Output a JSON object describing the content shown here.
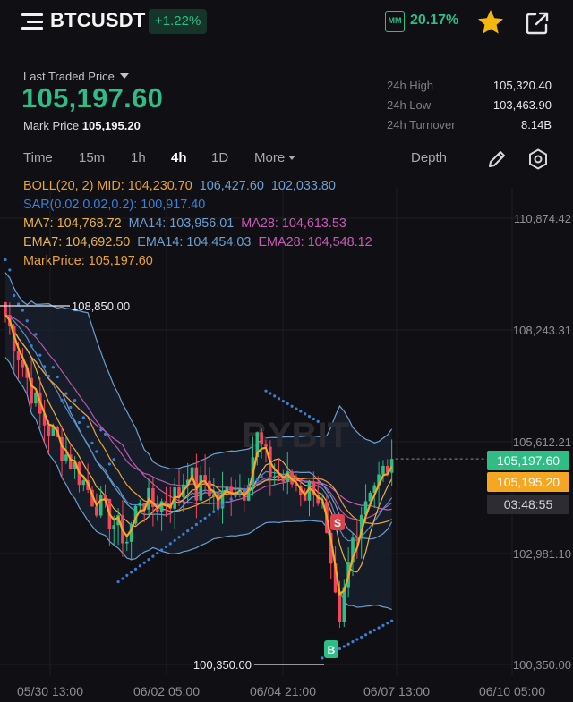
{
  "header": {
    "symbol": "BTCUSDT",
    "change": "+1.22%",
    "mm_label": "MM",
    "mm_value": "20.17%",
    "icons": [
      "menu-icon",
      "star-icon",
      "share-icon"
    ]
  },
  "ticker": {
    "last_traded_label": "Last Traded Price",
    "last_price": "105,197.60",
    "mark_label": "Mark Price",
    "mark_price": "105,195.20"
  },
  "stats": [
    {
      "label": "24h High",
      "value": "105,320.40"
    },
    {
      "label": "24h Low",
      "value": "103,463.90"
    },
    {
      "label": "24h Turnover",
      "value": "8.14B"
    }
  ],
  "toolbar": {
    "timeframes": [
      "Time",
      "15m",
      "1h",
      "4h",
      "1D"
    ],
    "active": "4h",
    "more": "More",
    "depth": "Depth"
  },
  "indicators": [
    [
      {
        "text": "BOLL(20, 2) MID: 104,230.70",
        "color": "#e9a23b"
      },
      {
        "text": "106,427.60",
        "color": "#6c9fd0"
      },
      {
        "text": "102,033.80",
        "color": "#6c9fd0"
      }
    ],
    [
      {
        "text": "SAR(0.02,0.02,0.2): 100,917.40",
        "color": "#3b7fd8"
      }
    ],
    [
      {
        "text": "MA7: 104,768.72",
        "color": "#e9b34b"
      },
      {
        "text": "MA14: 103,956.01",
        "color": "#6c9fd0"
      },
      {
        "text": "MA28: 104,613.53",
        "color": "#c65bb5"
      }
    ],
    [
      {
        "text": "EMA7: 104,692.50",
        "color": "#e9b34b"
      },
      {
        "text": "EMA14: 104,454.03",
        "color": "#6c9fd0"
      },
      {
        "text": "EMA28: 104,548.12",
        "color": "#c65bb5"
      }
    ],
    [
      {
        "text": "MarkPrice: 105,197.60",
        "color": "#e9a23b"
      }
    ]
  ],
  "chart": {
    "y_axis_labels": [
      "110,874.42",
      "108,243.31",
      "105,612.21",
      "102,981.10",
      "100,350.00"
    ],
    "x_axis_labels": [
      "05/30 13:00",
      "06/02 05:00",
      "06/04 21:00",
      "06/07 13:00",
      "06/10 05:00"
    ],
    "high_marker": "108,850.00",
    "low_marker": "100,350.00",
    "last_price_tag": "105,197.60",
    "mark_price_tag": "105,195.20",
    "countdown": "03:48:55",
    "watermark": "BYBIT",
    "signal_sell": "S",
    "signal_buy": "B",
    "colors": {
      "up": "#2dbd85",
      "down": "#f6465d",
      "mark": "#f5a623"
    }
  }
}
